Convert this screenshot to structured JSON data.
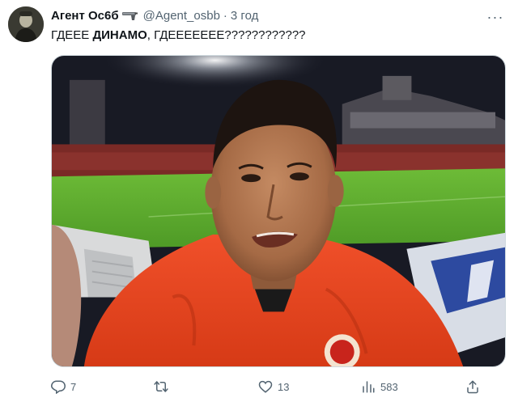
{
  "tweet": {
    "display_name": "Агент Ос6б",
    "handle": "@Agent_osbb",
    "separator": "·",
    "time": "3 год",
    "text_prefix": "ГДЕЕЕ ",
    "text_bold": "ДИНАМО",
    "text_suffix": ", ГДЕЕЕЕЕЕЕ????????????",
    "more_label": "···"
  },
  "media": {
    "shirt_color": "#e8401e",
    "pitch_color": "#5fae2f",
    "sky_color": "#1a1c28"
  },
  "actions": {
    "reply_count": "7",
    "retweet_count": "",
    "like_count": "13",
    "views_count": "583"
  },
  "icons": [
    "avatar",
    "gun-icon",
    "more-icon",
    "reply-icon",
    "retweet-icon",
    "like-icon",
    "views-icon",
    "share-icon"
  ]
}
